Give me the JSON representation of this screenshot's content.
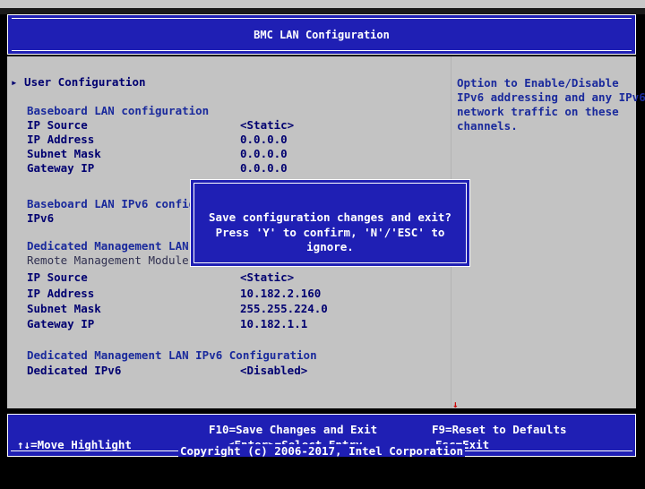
{
  "title": "BMC LAN Configuration",
  "menu": {
    "user_configuration": "▸ User Configuration"
  },
  "baseboard": {
    "heading": "Baseboard LAN configuration",
    "rows": [
      {
        "label": "IP Source",
        "value": "<Static>"
      },
      {
        "label": "IP Address",
        "value": "0.0.0.0"
      },
      {
        "label": "Subnet Mask",
        "value": "0.0.0.0"
      },
      {
        "label": "Gateway IP",
        "value": "0.0.0.0"
      }
    ]
  },
  "baseboard_ipv6": {
    "heading": "Baseboard LAN IPv6 config",
    "row_label": "IPv6"
  },
  "dedicated": {
    "heading": "Dedicated Management LAN",
    "rmm_label": "Remote Management Module",
    "rows": [
      {
        "label": "IP Source",
        "value": "<Static>"
      },
      {
        "label": "IP Address",
        "value": "10.182.2.160"
      },
      {
        "label": "Subnet Mask",
        "value": "255.255.224.0"
      },
      {
        "label": "Gateway IP",
        "value": "10.182.1.1"
      }
    ]
  },
  "dedicated_ipv6": {
    "heading": "Dedicated Management LAN IPv6 Configuration",
    "label": "Dedicated IPv6",
    "value": "<Disabled>"
  },
  "help": {
    "lines": [
      "Option to Enable/Disable",
      "IPv6 addressing and any IPv6",
      "network traffic on these",
      "channels."
    ]
  },
  "dialog": {
    "line1": "Save configuration changes and exit?",
    "line2": "Press 'Y' to confirm, 'N'/'ESC' to ignore."
  },
  "footer": {
    "move_highlight": "↑↓=Move Highlight",
    "save_exit": "F10=Save Changes and Exit",
    "select_entry": "<Enter>=Select Entry",
    "reset_defaults": "F9=Reset to Defaults",
    "esc_exit": "Esc=Exit",
    "copyright": "Copyright (c) 2006-2017, Intel Corporation"
  },
  "colors": {
    "panel_blue": "#1f1fb4",
    "body_gray": "#c3c3c3",
    "heading_blue": "#1a2a9c",
    "text_navy": "#000070"
  }
}
